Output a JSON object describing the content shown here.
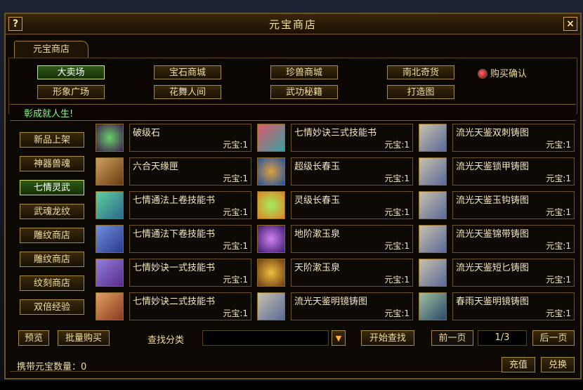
{
  "window": {
    "title": "元宝商店"
  },
  "tab": {
    "label": "元宝商店"
  },
  "categories": [
    {
      "label": "大卖场"
    },
    {
      "label": "宝石商城"
    },
    {
      "label": "珍兽商城"
    },
    {
      "label": "南北奇货"
    },
    {
      "label": "形象广场"
    },
    {
      "label": "花舞人间"
    },
    {
      "label": "武功秘籍"
    },
    {
      "label": "打造图"
    }
  ],
  "purchase_confirm": {
    "label": "购买确认"
  },
  "marquee": {
    "text": "彰成就人生!"
  },
  "sidebar": {
    "items": [
      {
        "label": "新品上架"
      },
      {
        "label": "神器兽魂"
      },
      {
        "label": "七情灵武"
      },
      {
        "label": "武魂龙纹"
      },
      {
        "label": "雕纹商店"
      },
      {
        "label": "雕纹商店"
      },
      {
        "label": "纹刻商店"
      },
      {
        "label": "双倍经验"
      }
    ]
  },
  "items": [
    {
      "name": "破级石",
      "price": "元宝:1",
      "icon": "gem-icon"
    },
    {
      "name": "七情妙诀三式技能书",
      "price": "元宝:1",
      "icon": "skill-book-icon"
    },
    {
      "name": "流光天鉴双刺铸图",
      "price": "元宝:1",
      "icon": "scroll-icon"
    },
    {
      "name": "六合天缘匣",
      "price": "元宝:1",
      "icon": "chest-icon"
    },
    {
      "name": "超级长春玉",
      "price": "元宝:1",
      "icon": "jade-icon"
    },
    {
      "name": "流光天鉴锁甲铸图",
      "price": "元宝:1",
      "icon": "scroll-icon"
    },
    {
      "name": "七情通法上卷技能书",
      "price": "元宝:1",
      "icon": "skill-book-icon"
    },
    {
      "name": "灵级长春玉",
      "price": "元宝:1",
      "icon": "jade-icon"
    },
    {
      "name": "流光天鉴玉钩铸图",
      "price": "元宝:1",
      "icon": "scroll-icon"
    },
    {
      "name": "七情通法下卷技能书",
      "price": "元宝:1",
      "icon": "skill-book-icon"
    },
    {
      "name": "地阶漱玉泉",
      "price": "元宝:1",
      "icon": "potion-icon"
    },
    {
      "name": "流光天鉴锦带铸图",
      "price": "元宝:1",
      "icon": "scroll-icon"
    },
    {
      "name": "七情妙诀一式技能书",
      "price": "元宝:1",
      "icon": "skill-book-icon"
    },
    {
      "name": "天阶漱玉泉",
      "price": "元宝:1",
      "icon": "potion-icon"
    },
    {
      "name": "流光天鉴短匕铸图",
      "price": "元宝:1",
      "icon": "scroll-icon"
    },
    {
      "name": "七情妙诀二式技能书",
      "price": "元宝:1",
      "icon": "skill-book-icon"
    },
    {
      "name": "流光天鉴明镜铸图",
      "price": "元宝:1",
      "icon": "scroll-icon"
    },
    {
      "name": "春雨天鉴明镜铸图",
      "price": "元宝:1",
      "icon": "scroll-icon"
    }
  ],
  "footer": {
    "preview_label": "预览",
    "bulk_buy_label": "批量购买",
    "search_label": "查找分类",
    "search_value": "",
    "start_search_label": "开始查找",
    "prev_page_label": "前一页",
    "page_indicator": "1/3",
    "next_page_label": "后一页"
  },
  "status": {
    "currency_text": "携带元宝数量：0",
    "recharge_label": "充值",
    "exchange_label": "兑换"
  },
  "colors": {
    "gold_border": "#a88a3e",
    "selected_green": "#2f5a18",
    "text_gold": "#f0dca0"
  }
}
